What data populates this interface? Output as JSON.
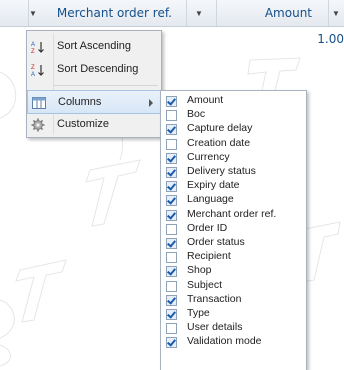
{
  "grid": {
    "columns": [
      {
        "label": ""
      },
      {
        "label": "Merchant order ref."
      },
      {
        "label": "Amount"
      },
      {
        "label": ""
      }
    ],
    "row_value": "1.00"
  },
  "menu": {
    "items": [
      {
        "label": "Sort Ascending",
        "icon": "sort-ascending-icon"
      },
      {
        "label": "Sort Descending",
        "icon": "sort-descending-icon"
      },
      {
        "label": "Columns",
        "icon": "columns-icon"
      },
      {
        "label": "Customize",
        "icon": "customize-gear-icon"
      }
    ]
  },
  "columns_submenu": {
    "items": [
      {
        "label": "Amount",
        "checked": true
      },
      {
        "label": "Boc",
        "checked": false
      },
      {
        "label": "Capture delay",
        "checked": true
      },
      {
        "label": "Creation date",
        "checked": false
      },
      {
        "label": "Currency",
        "checked": true
      },
      {
        "label": "Delivery status",
        "checked": true
      },
      {
        "label": "Expiry date",
        "checked": true
      },
      {
        "label": "Language",
        "checked": true
      },
      {
        "label": "Merchant order ref.",
        "checked": true
      },
      {
        "label": "Order ID",
        "checked": false
      },
      {
        "label": "Order status",
        "checked": true
      },
      {
        "label": "Recipient",
        "checked": false
      },
      {
        "label": "Shop",
        "checked": true
      },
      {
        "label": "Subject",
        "checked": false
      },
      {
        "label": "Transaction",
        "checked": true
      },
      {
        "label": "Type",
        "checked": true
      },
      {
        "label": "User details",
        "checked": false
      },
      {
        "label": "Validation mode",
        "checked": true
      }
    ]
  },
  "colors": {
    "header_text": "#15508a",
    "menu_bg": "#f0f0f0",
    "highlight_border": "#a8c4e3",
    "check": "#1a5cab"
  }
}
